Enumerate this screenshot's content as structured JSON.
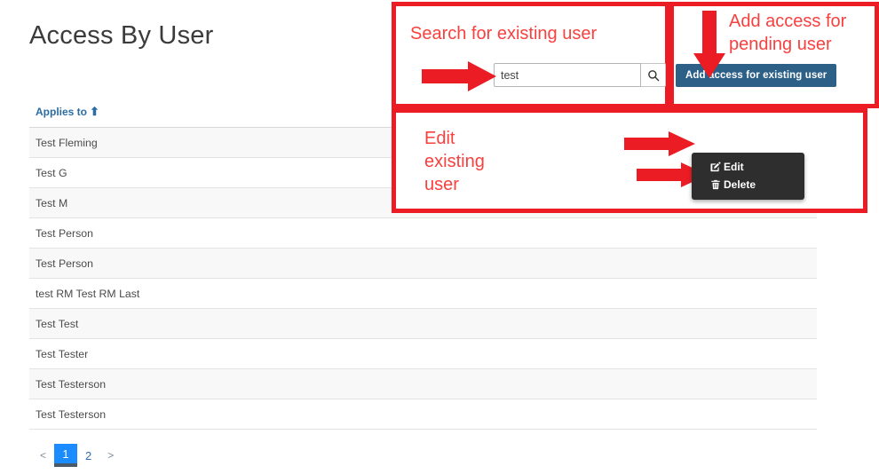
{
  "page": {
    "title": "Access By User"
  },
  "search": {
    "value": "test",
    "placeholder": "",
    "icon": "search-icon"
  },
  "actions": {
    "add_access_label": "Add access for existing user"
  },
  "table": {
    "columns": [
      {
        "label": "Applies to",
        "sort": "ascending",
        "sort_glyph": "⬆"
      }
    ],
    "rows": [
      {
        "applies_to": "Test Fleming"
      },
      {
        "applies_to": "Test G"
      },
      {
        "applies_to": "Test M"
      },
      {
        "applies_to": "Test Person"
      },
      {
        "applies_to": "Test Person"
      },
      {
        "applies_to": "test RM Test RM Last"
      },
      {
        "applies_to": "Test Test"
      },
      {
        "applies_to": "Test Tester"
      },
      {
        "applies_to": "Test Testerson"
      },
      {
        "applies_to": "Test Testerson"
      }
    ]
  },
  "context_menu": {
    "items": [
      {
        "label": "Edit",
        "icon": "pencil-square-icon"
      },
      {
        "label": "Delete",
        "icon": "trash-icon"
      }
    ]
  },
  "pagination": {
    "prev": "<",
    "next": ">",
    "pages": [
      "1",
      "2"
    ],
    "active": "1"
  },
  "annotations": [
    {
      "id": "search",
      "text": "Search for existing user"
    },
    {
      "id": "add",
      "text": "Add access for\npending user"
    },
    {
      "id": "edit",
      "text": "Edit\nexisting\nuser"
    }
  ],
  "colors": {
    "annotation_red": "#ec1c24",
    "annotation_text_red": "#f6413f",
    "button_blue": "#2c6087",
    "header_link_blue": "#2b6ca3",
    "active_page_blue": "#1a8cff",
    "menu_dark": "#2e2e2e"
  }
}
